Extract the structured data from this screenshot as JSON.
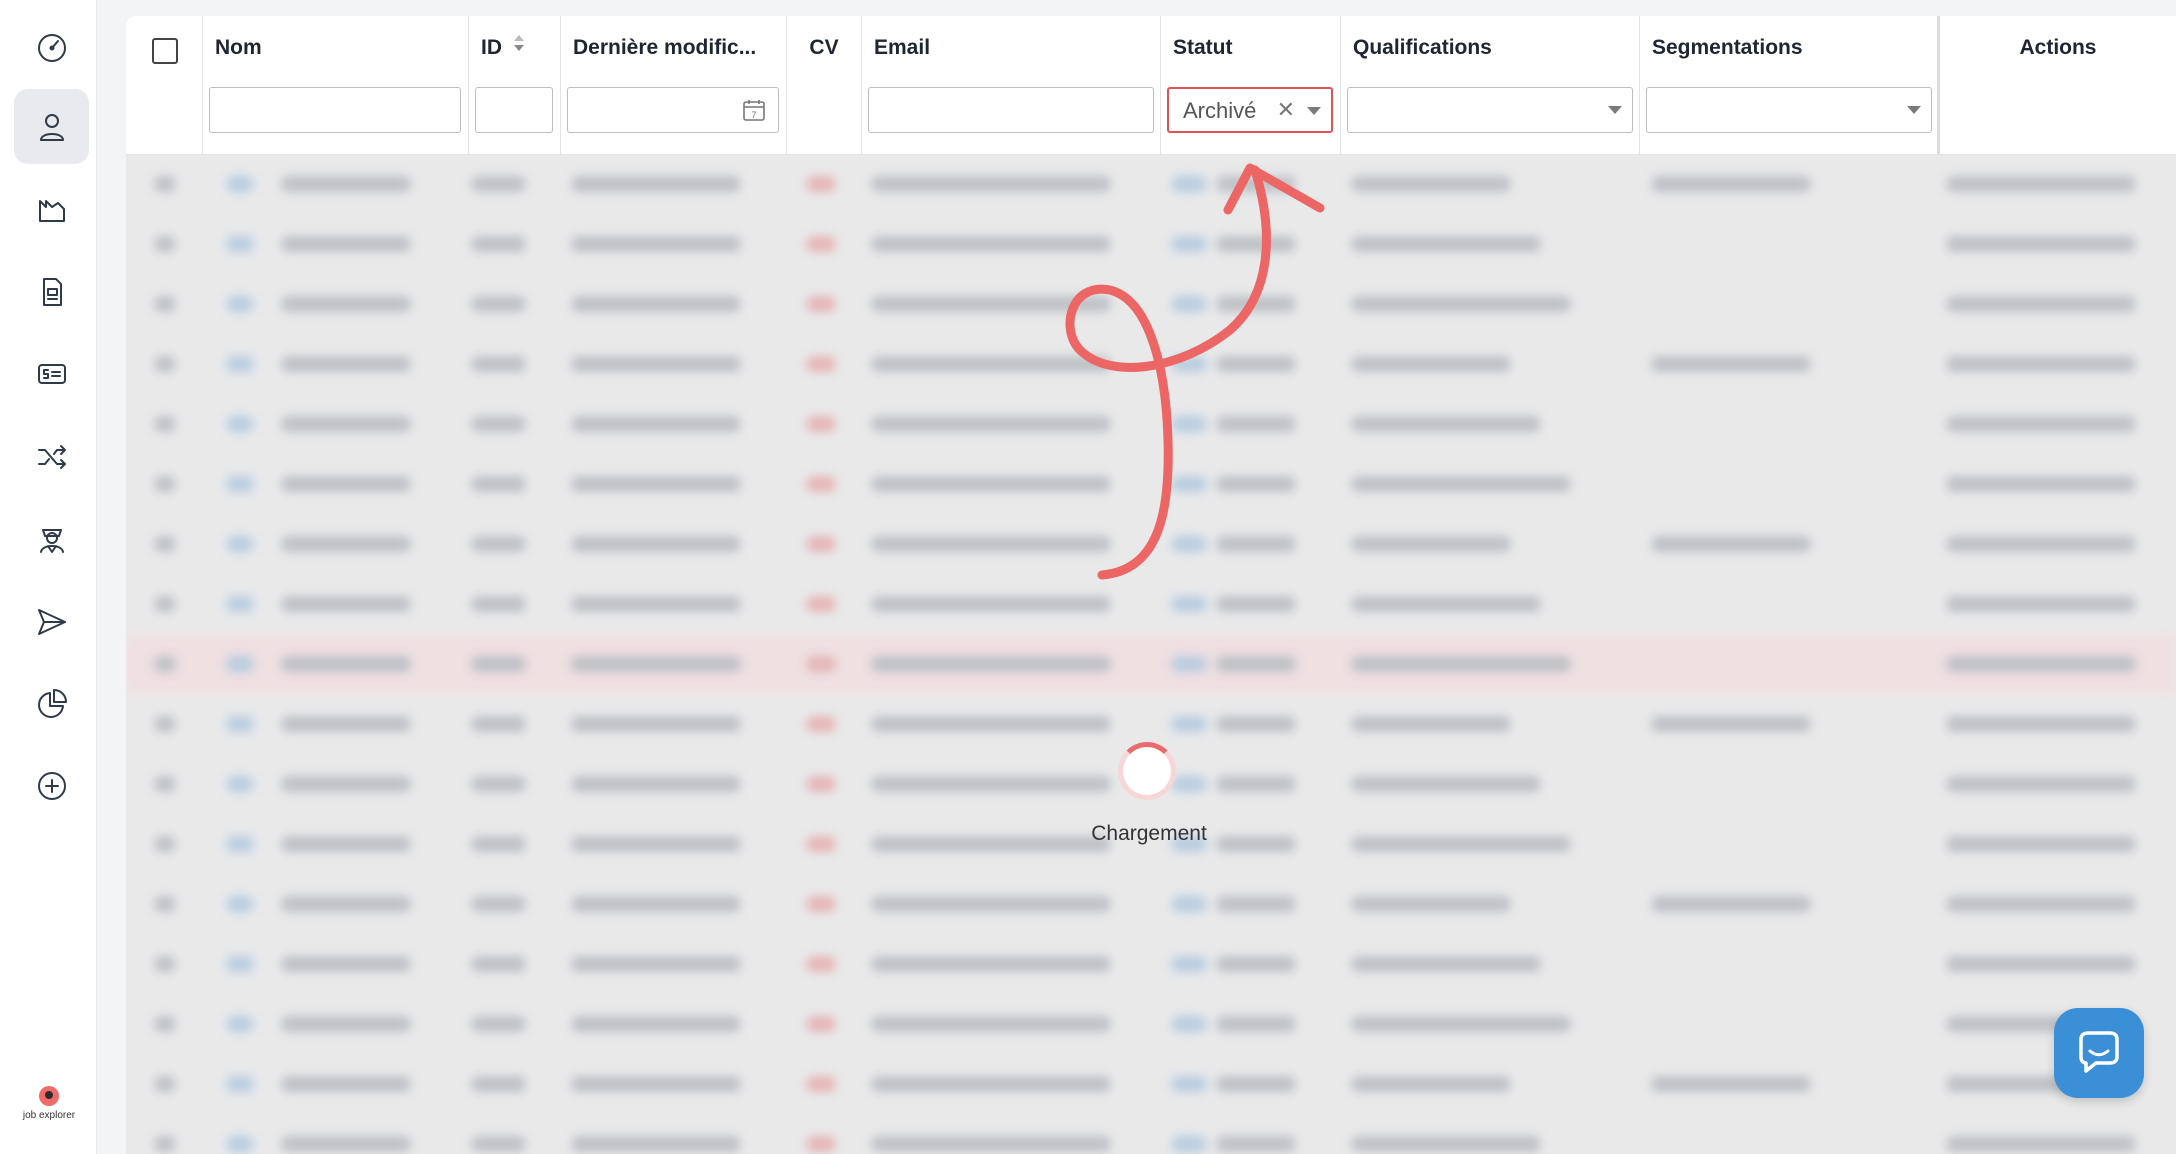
{
  "sidebar": {
    "items": [
      {
        "name": "dashboard",
        "icon": "speedometer-icon"
      },
      {
        "name": "candidates",
        "icon": "user-icon",
        "active": true
      },
      {
        "name": "companies",
        "icon": "factory-icon"
      },
      {
        "name": "documents",
        "icon": "document-icon"
      },
      {
        "name": "billing",
        "icon": "money-card-icon"
      },
      {
        "name": "matching",
        "icon": "shuffle-icon"
      },
      {
        "name": "recruiters",
        "icon": "team-icon"
      },
      {
        "name": "campaigns",
        "icon": "send-icon"
      },
      {
        "name": "statistics",
        "icon": "pie-chart-icon"
      },
      {
        "name": "add",
        "icon": "plus-circle-icon"
      }
    ],
    "logo_text": "job explorer"
  },
  "table": {
    "columns": [
      {
        "label": "Nom"
      },
      {
        "label": "ID"
      },
      {
        "label": "Dernière modific..."
      },
      {
        "label": "CV"
      },
      {
        "label": "Email"
      },
      {
        "label": "Statut"
      },
      {
        "label": "Qualifications"
      },
      {
        "label": "Segmentations"
      },
      {
        "label": "Actions"
      }
    ],
    "filters": {
      "nom": "",
      "id": "",
      "date": "",
      "date_icon_day": "7",
      "email": "",
      "statut": "Archivé",
      "qualifications": "",
      "segmentations": ""
    }
  },
  "loading": {
    "text": "Chargement"
  },
  "colors": {
    "accent": "#ea6b6b",
    "chat": "#3a8fd6",
    "status_border": "#e0525a"
  }
}
